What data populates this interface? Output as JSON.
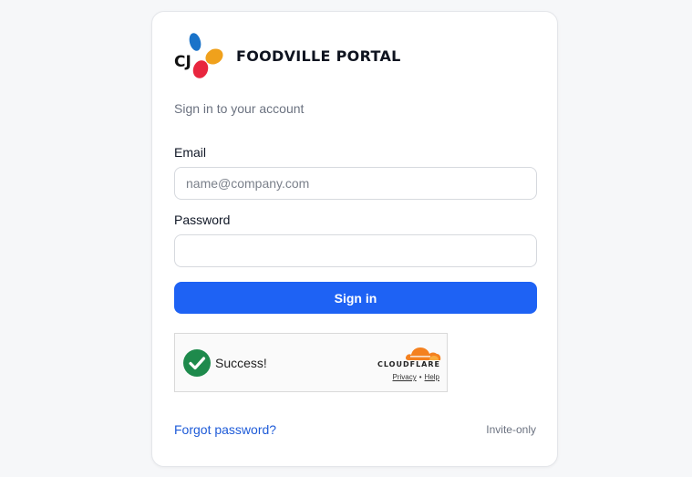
{
  "brand": {
    "logo_text": "CJ",
    "name": "FOODVILLE PORTAL",
    "logo_colors": {
      "blue": "#1a73c9",
      "orange": "#f0a11c",
      "red": "#e8263e"
    }
  },
  "form": {
    "subtitle": "Sign in to your account",
    "email_label": "Email",
    "email_placeholder": "name@company.com",
    "email_value": "",
    "password_label": "Password",
    "password_value": "",
    "submit_label": "Sign in",
    "accent_color": "#1e62f4"
  },
  "captcha": {
    "status": "Success!",
    "provider": "CLOUDFLARE",
    "privacy_link": "Privacy",
    "separator": "•",
    "help_link": "Help",
    "check_color": "#1e8a4c",
    "cloud_color": "#f48120"
  },
  "footer": {
    "forgot_link": "Forgot password?",
    "note": "Invite-only"
  }
}
